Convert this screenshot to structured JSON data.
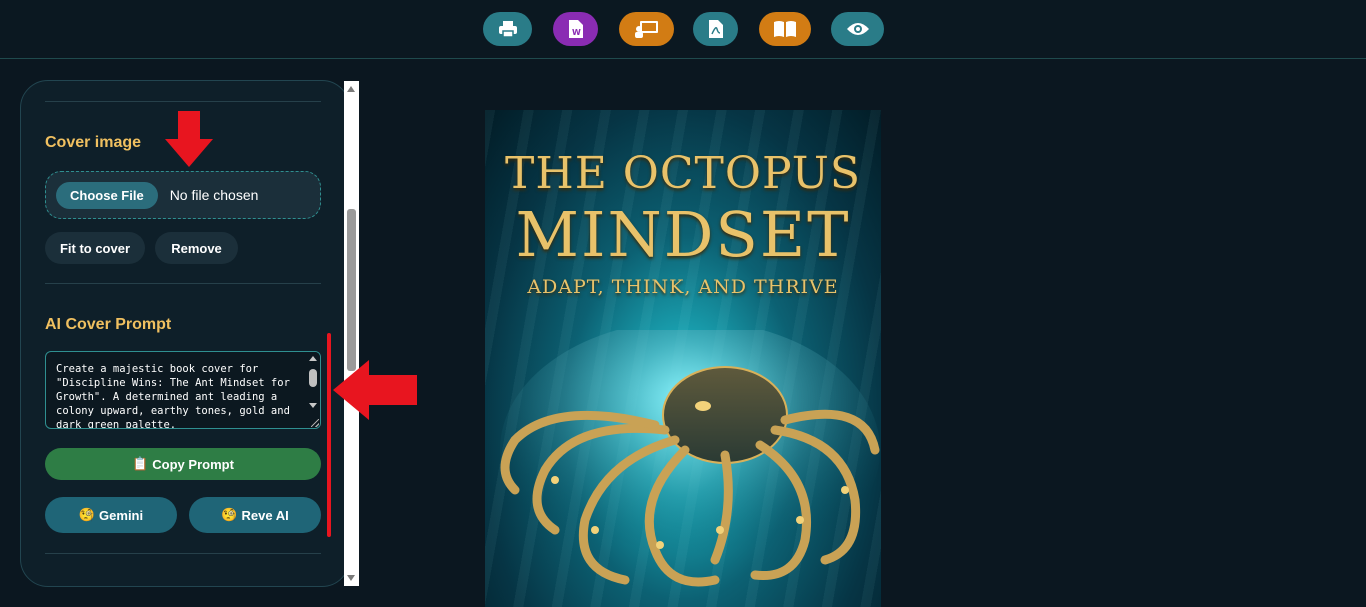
{
  "toolbar": {
    "buttons": [
      {
        "icon": "printer-icon",
        "color": "#2a7c88"
      },
      {
        "icon": "word-document-icon",
        "color": "#8a2cb3"
      },
      {
        "icon": "presentation-icon",
        "color": "#d27c14"
      },
      {
        "icon": "pdf-document-icon",
        "color": "#2a7c88"
      },
      {
        "icon": "open-book-icon",
        "color": "#d27c14"
      },
      {
        "icon": "eye-preview-icon",
        "color": "#2a7c88"
      }
    ]
  },
  "sidebar": {
    "cover_image": {
      "title": "Cover image",
      "choose_file_label": "Choose File",
      "file_status": "No file chosen",
      "fit_label": "Fit to cover",
      "remove_label": "Remove"
    },
    "ai_prompt": {
      "title": "AI Cover Prompt",
      "prompt_text": "Create a majestic book cover for \"Discipline Wins: The Ant Mindset for Growth\". A determined ant leading a colony upward, earthy tones, gold and dark green palette.",
      "copy_label": "Copy Prompt",
      "copy_icon": "📋",
      "gemini_label": "Gemini",
      "reve_label": "Reve AI",
      "ai_icon": "🧐"
    }
  },
  "cover": {
    "title_line1": "THE OCTOPUS",
    "title_line2": "MINDSET",
    "subtitle": "ADAPT, THINK, AND THRIVE"
  },
  "annotations": {
    "color": "#e8151f"
  }
}
